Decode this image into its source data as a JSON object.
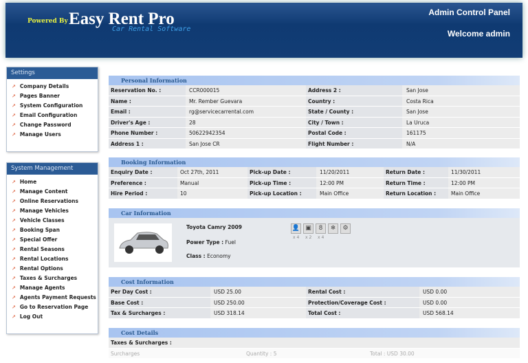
{
  "header": {
    "powered_by": "Powered By",
    "logo": "Easy Rent Pro",
    "tagline": "Car Rental Software",
    "panel": "Admin Control Panel",
    "welcome": "Welcome admin"
  },
  "settings": {
    "title": "Settings",
    "items": [
      "Company Details",
      "Pages Banner",
      "System Configuration",
      "Email Configuration",
      "Change Password",
      "Manage Users"
    ]
  },
  "system": {
    "title": "System Management",
    "items": [
      "Home",
      "Manage Content",
      "Online Reservations",
      "Manage Vehicles",
      "Vehicle Classes",
      "Booking Span",
      "Special Offer",
      "Rental Seasons",
      "Rental Locations",
      "Rental Options",
      "Taxes & Surcharges",
      "Manage Agents",
      "Agents Payment Requests",
      "Go to Reservation Page",
      "Log Out"
    ]
  },
  "personal": {
    "title": "Personal Information",
    "rows": [
      [
        "Reservation No. :",
        "CCR000015",
        "Address 2 :",
        "San Jose"
      ],
      [
        "Name :",
        "Mr. Rember Guevara",
        "Country :",
        "Costa Rica"
      ],
      [
        "Email :",
        "rg@servicecarrental.com",
        "State / County :",
        "San Jose"
      ],
      [
        "Driver's Age :",
        "28",
        "City / Town :",
        "La Uruca"
      ],
      [
        "Phone Number :",
        "50622942354",
        "Postal Code :",
        "161175"
      ],
      [
        "Address 1 :",
        "San Jose CR",
        "Flight Number :",
        "N/A"
      ]
    ]
  },
  "booking": {
    "title": "Booking Information",
    "rows": [
      [
        "Enquiry Date :",
        "Oct 27th, 2011",
        "Pick-up Date :",
        "11/20/2011",
        "Return Date :",
        "11/30/2011"
      ],
      [
        "Preference :",
        "Manual",
        "Pick-up Time :",
        "12:00 PM",
        "Return Time :",
        "12:00 PM"
      ],
      [
        "Hire Period :",
        "10",
        "Pick-up Location :",
        "Main Office",
        "Return Location :",
        "Main Office"
      ]
    ]
  },
  "car": {
    "title": "Car Information",
    "name": "Toyota Camry 2009",
    "power_label": "Power Type :",
    "power": "Fuel",
    "class_label": "Class :",
    "class": "Economy",
    "features": [
      {
        "icon": "passenger-icon",
        "glyph": "👤",
        "qty": "x 4"
      },
      {
        "icon": "luggage-icon",
        "glyph": "▣",
        "qty": "x 2"
      },
      {
        "icon": "door-icon",
        "glyph": "8",
        "qty": "x 4"
      },
      {
        "icon": "air-conditioning-icon",
        "glyph": "❄",
        "qty": ""
      },
      {
        "icon": "transmission-icon",
        "glyph": "⚙",
        "qty": ""
      }
    ]
  },
  "cost": {
    "title": "Cost Information",
    "rows": [
      [
        "Per Day Cost :",
        "USD 25.00",
        "Rental Cost :",
        "USD 0.00"
      ],
      [
        "Base Cost :",
        "USD 250.00",
        "Protection/Coverage Cost :",
        "USD 0.00"
      ],
      [
        "Tax & Surcharges :",
        "USD 318.14",
        "Total Cost :",
        "USD 568.14"
      ]
    ]
  },
  "details": {
    "title": "Cost Details",
    "subtitle": "Taxes & Surcharges :",
    "item": "Surcharges",
    "quantity": "Quantity : 5",
    "total": "Total : USD 30.00"
  }
}
